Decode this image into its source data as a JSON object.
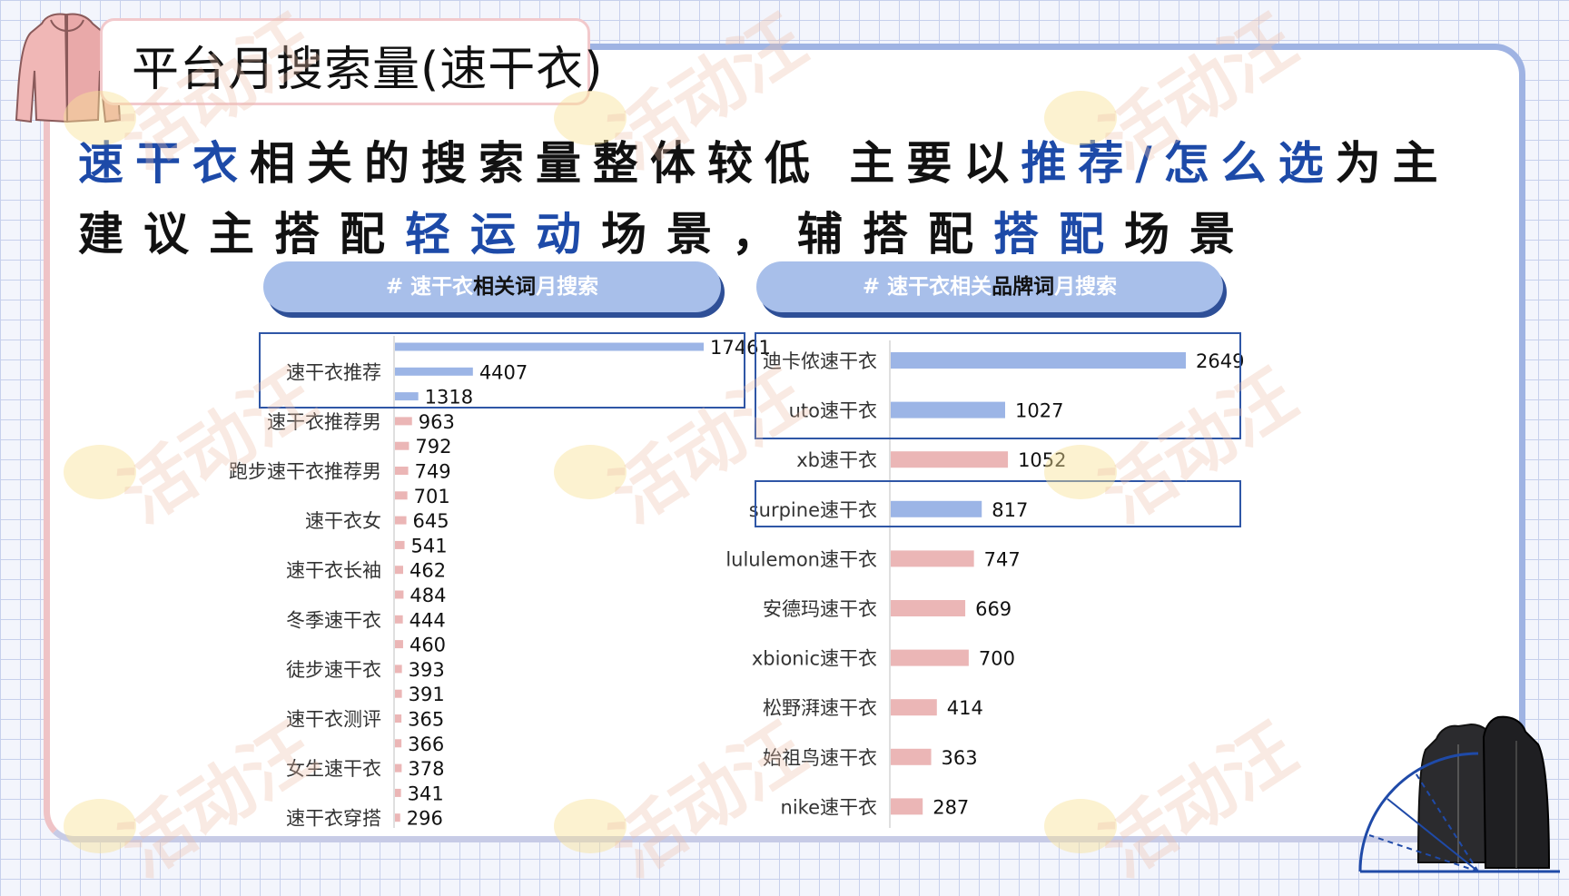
{
  "header": {
    "title": "平台月搜索量(速干衣)"
  },
  "headline": {
    "line1": [
      {
        "text": "速干衣",
        "accent": true
      },
      {
        "text": "相关的搜索量整体较低  主要以",
        "accent": false
      },
      {
        "text": "推荐/怎么选",
        "accent": true
      },
      {
        "text": "为主",
        "accent": false
      }
    ],
    "line2": [
      {
        "text": "建议主搭配",
        "accent": false
      },
      {
        "text": "轻运动",
        "accent": true
      },
      {
        "text": "场景，辅搭配",
        "accent": false
      },
      {
        "text": "搭配",
        "accent": true
      },
      {
        "text": "场景",
        "accent": false
      }
    ]
  },
  "pills": {
    "left": {
      "hash": "# ",
      "pre": "速干衣",
      "strong": "相关词",
      "post": "月搜索"
    },
    "right": {
      "hash": "# ",
      "pre": "速干衣相关",
      "strong": "品牌词",
      "post": "月搜索"
    }
  },
  "watermark": "活动汪",
  "colors": {
    "blue_bar": "#9cb5e6",
    "pink_bar": "#ebb6b6",
    "accent": "#1d4aa8",
    "highlight_border": "#2f56a6"
  },
  "chart_data": [
    {
      "type": "bar",
      "orientation": "horizontal",
      "category_labels": [
        {
          "label": "速干衣推荐",
          "row": 1
        },
        {
          "label": "速干衣推荐男",
          "row": 3
        },
        {
          "label": "跑步速干衣推荐男",
          "row": 5
        },
        {
          "label": "速干衣女",
          "row": 7
        },
        {
          "label": "速干衣长袖",
          "row": 9
        },
        {
          "label": "冬季速干衣",
          "row": 11
        },
        {
          "label": "徒步速干衣",
          "row": 13
        },
        {
          "label": "速干衣测评",
          "row": 15
        },
        {
          "label": "女生速干衣",
          "row": 17
        },
        {
          "label": "速干衣穿搭",
          "row": 19
        }
      ],
      "values": [
        17461,
        4407,
        1318,
        963,
        792,
        749,
        701,
        645,
        541,
        462,
        484,
        444,
        460,
        393,
        391,
        365,
        366,
        378,
        341,
        296
      ],
      "highlight_rows": [
        0,
        1,
        2
      ],
      "xlim": [
        0,
        17461
      ]
    },
    {
      "type": "bar",
      "orientation": "horizontal",
      "categories": [
        "迪卡侬速干衣",
        "uto速干衣",
        "xb速干衣",
        "surpine速干衣",
        "lululemon速干衣",
        "安德玛速干衣",
        "xbionic速干衣",
        "松野湃速干衣",
        "始祖鸟速干衣",
        "nike速干衣"
      ],
      "values": [
        2649,
        1027,
        1052,
        817,
        747,
        669,
        700,
        414,
        363,
        287
      ],
      "highlight_rows": [
        0,
        1,
        3
      ],
      "xlim": [
        0,
        2649
      ]
    }
  ]
}
